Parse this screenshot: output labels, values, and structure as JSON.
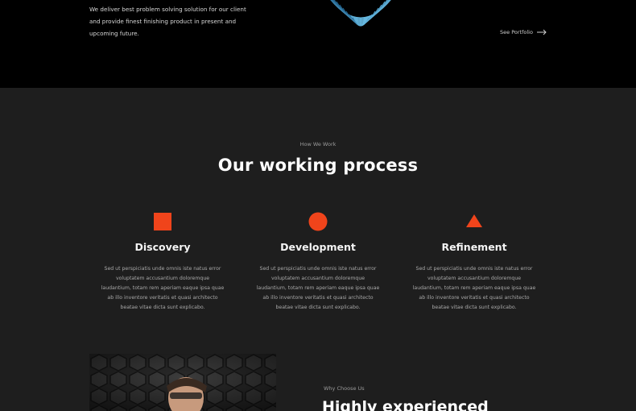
{
  "hero": {
    "intro": "We deliver best problem solving solution for our client and provide finest finishing product in present and upcoming future.",
    "portfolio_link": "See Portfolio",
    "arrow_icon": "arrow-right-icon"
  },
  "process": {
    "eyebrow": "How We Work",
    "heading": "Our working process",
    "accent_color": "#f0441b",
    "steps": [
      {
        "icon": "square-icon",
        "title": "Discovery",
        "description": "Sed ut perspiciatis unde omnis iste natus error voluptatem accusantium doloremque laudantium, totam rem aperiam eaque ipsa quae ab illo inventore veritatis et quasi architecto beatae vitae dicta sunt explicabo."
      },
      {
        "icon": "circle-icon",
        "title": "Development",
        "description": "Sed ut perspiciatis unde omnis iste natus error voluptatem accusantium doloremque laudantium, totam rem aperiam eaque ipsa quae ab illo inventore veritatis et quasi architecto beatae vitae dicta sunt explicabo."
      },
      {
        "icon": "triangle-icon",
        "title": "Refinement",
        "description": "Sed ut perspiciatis unde omnis iste natus error voluptatem accusantium doloremque laudantium, totam rem aperiam eaque ipsa quae ab illo inventore veritatis et quasi architecto beatae vitae dicta sunt explicabo."
      }
    ]
  },
  "why": {
    "eyebrow": "Why Choose Us",
    "heading": "Highly experienced"
  }
}
